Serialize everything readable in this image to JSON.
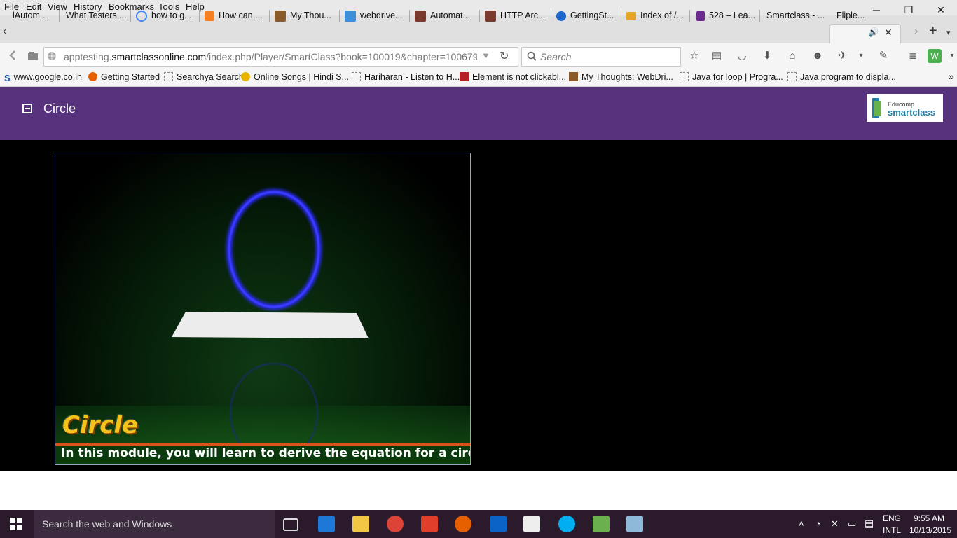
{
  "menubar": {
    "items": [
      "File",
      "Edit",
      "View",
      "History",
      "Bookmarks",
      "Tools",
      "Help"
    ]
  },
  "window_controls": {
    "minimize": "─",
    "restore": "❐",
    "close": "✕"
  },
  "tabs": [
    {
      "label": "lAutom...",
      "icon": "tab-icon-generic",
      "color": "#777777"
    },
    {
      "label": "What Testers ...",
      "icon": "tab-icon-generic",
      "color": "#777777"
    },
    {
      "label": "how to g...",
      "icon": "google-icon",
      "color": "#4285f4"
    },
    {
      "label": "How can ...",
      "icon": "stackoverflow-icon",
      "color": "#f48024"
    },
    {
      "label": "My Thou...",
      "icon": "blog-icon",
      "color": "#8a5a2b"
    },
    {
      "label": "webdrive...",
      "icon": "qa-icon",
      "color": "#3d8fd6"
    },
    {
      "label": "Automat...",
      "icon": "avatar-icon",
      "color": "#7a3b2e"
    },
    {
      "label": "HTTP Arc...",
      "icon": "avatar-icon",
      "color": "#7a3b2e"
    },
    {
      "label": "GettingSt...",
      "icon": "github-pages-icon",
      "color": "#1e66c9"
    },
    {
      "label": "Index of /...",
      "icon": "folder-star-icon",
      "color": "#e8a32a"
    },
    {
      "label": "528 – Lea...",
      "icon": "f-icon",
      "color": "#6b2b8f"
    },
    {
      "label": "Smartclass - ...",
      "icon": "",
      "color": ""
    },
    {
      "label": "Fliple...",
      "icon": "",
      "color": ""
    }
  ],
  "active_tab_index": 12,
  "tab_actions": {
    "scroll_left": "‹",
    "scroll_right": "›",
    "new_tab": "+",
    "list_all": "▾",
    "audio": "🔊",
    "close": "✕"
  },
  "navbar": {
    "url_prefix": "apptesting.",
    "url_domain": "smartclassonline.com",
    "url_rest": "/index.php/Player/SmartClass?book=100019&chapter=100679",
    "search_placeholder": "Search"
  },
  "bookmarks": [
    {
      "label": "www.google.co.in",
      "icon": "s-icon",
      "color": "#1a55b8"
    },
    {
      "label": "Getting Started",
      "icon": "firefox-icon",
      "color": "#e66000"
    },
    {
      "label": "Searchya Search",
      "icon": "blank-icon",
      "color": ""
    },
    {
      "label": "Online Songs | Hindi S...",
      "icon": "smiley-icon",
      "color": "#e8b400"
    },
    {
      "label": "Hariharan - Listen to H...",
      "icon": "blank-icon",
      "color": ""
    },
    {
      "label": "Element is not clickabl...",
      "icon": "stackexchange-icon",
      "color": "#b52025"
    },
    {
      "label": "My Thoughts: WebDri...",
      "icon": "blog-icon",
      "color": "#8a5a2b"
    },
    {
      "label": "Java for loop | Progra...",
      "icon": "blank-icon",
      "color": ""
    },
    {
      "label": "Java program to displa...",
      "icon": "blank-icon",
      "color": ""
    }
  ],
  "bookmarks_overflow": "»",
  "page": {
    "title": "Circle",
    "logo_top": "Educomp",
    "logo_bottom": "smartclass",
    "header_color": "#56337c"
  },
  "video": {
    "title": "Circle",
    "subtitle": "In this module, you will learn to derive the equation for a circle."
  },
  "taskbar": {
    "search_placeholder": "Search the web and Windows",
    "lang_top": "ENG",
    "lang_bottom": "INTL",
    "time": "9:55 AM",
    "date": "10/13/2015"
  }
}
